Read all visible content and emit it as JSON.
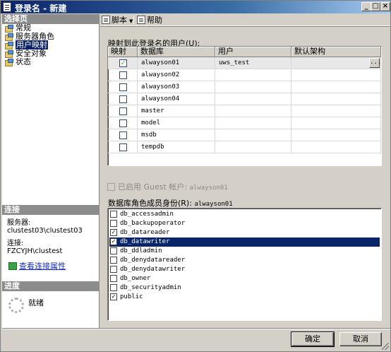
{
  "window": {
    "title": "登录名 - 新建"
  },
  "left": {
    "select_page_header": "选择页",
    "pages": [
      {
        "label": "常规",
        "selected": false
      },
      {
        "label": "服务器角色",
        "selected": false
      },
      {
        "label": "用户映射",
        "selected": true
      },
      {
        "label": "安全对象",
        "selected": false
      },
      {
        "label": "状态",
        "selected": false
      }
    ],
    "connection_header": "连接",
    "server_label": "服务器:",
    "server_value": "clustest03\\clustest03",
    "connection_label": "连接:",
    "connection_value": "FZCYJH\\clustest",
    "view_connection_properties": "查看连接属性",
    "progress_header": "进度",
    "status": "就绪"
  },
  "toolbar": {
    "script_label": "脚本",
    "help_label": "帮助"
  },
  "mapping": {
    "label": "映射到此登录名的用户(U):",
    "columns": [
      "映射",
      "数据库",
      "用户",
      "默认架构"
    ],
    "rows": [
      {
        "mapped": true,
        "database": "alwayson01",
        "user": "uws_test",
        "schema": "",
        "selected": true
      },
      {
        "mapped": false,
        "database": "alwayson02",
        "user": "",
        "schema": ""
      },
      {
        "mapped": false,
        "database": "alwayson03",
        "user": "",
        "schema": ""
      },
      {
        "mapped": false,
        "database": "alwayson04",
        "user": "",
        "schema": ""
      },
      {
        "mapped": false,
        "database": "master",
        "user": "",
        "schema": ""
      },
      {
        "mapped": false,
        "database": "model",
        "user": "",
        "schema": ""
      },
      {
        "mapped": false,
        "database": "msdb",
        "user": "",
        "schema": ""
      },
      {
        "mapped": false,
        "database": "tempdb",
        "user": "",
        "schema": ""
      }
    ],
    "ellipsis": "..."
  },
  "guest": {
    "label": "已启用 Guest 帐户:",
    "database": "alwayson01"
  },
  "roles": {
    "label": "数据库角色成员身份(R):",
    "database": "alwayson01",
    "items": [
      {
        "name": "db_accessadmin",
        "checked": false,
        "selected": false
      },
      {
        "name": "db_backupoperator",
        "checked": false,
        "selected": false
      },
      {
        "name": "db_datareader",
        "checked": true,
        "selected": false
      },
      {
        "name": "db_datawriter",
        "checked": true,
        "selected": true
      },
      {
        "name": "db_ddladmin",
        "checked": false,
        "selected": false
      },
      {
        "name": "db_denydatareader",
        "checked": false,
        "selected": false
      },
      {
        "name": "db_denydatawriter",
        "checked": false,
        "selected": false
      },
      {
        "name": "db_owner",
        "checked": false,
        "selected": false
      },
      {
        "name": "db_securityadmin",
        "checked": false,
        "selected": false
      },
      {
        "name": "public",
        "checked": true,
        "selected": false
      }
    ]
  },
  "buttons": {
    "ok": "确定",
    "cancel": "取消"
  },
  "glyphs": {
    "check": "✓",
    "minimize": "_",
    "maximize": "□",
    "close": "×",
    "caret": "▼"
  }
}
